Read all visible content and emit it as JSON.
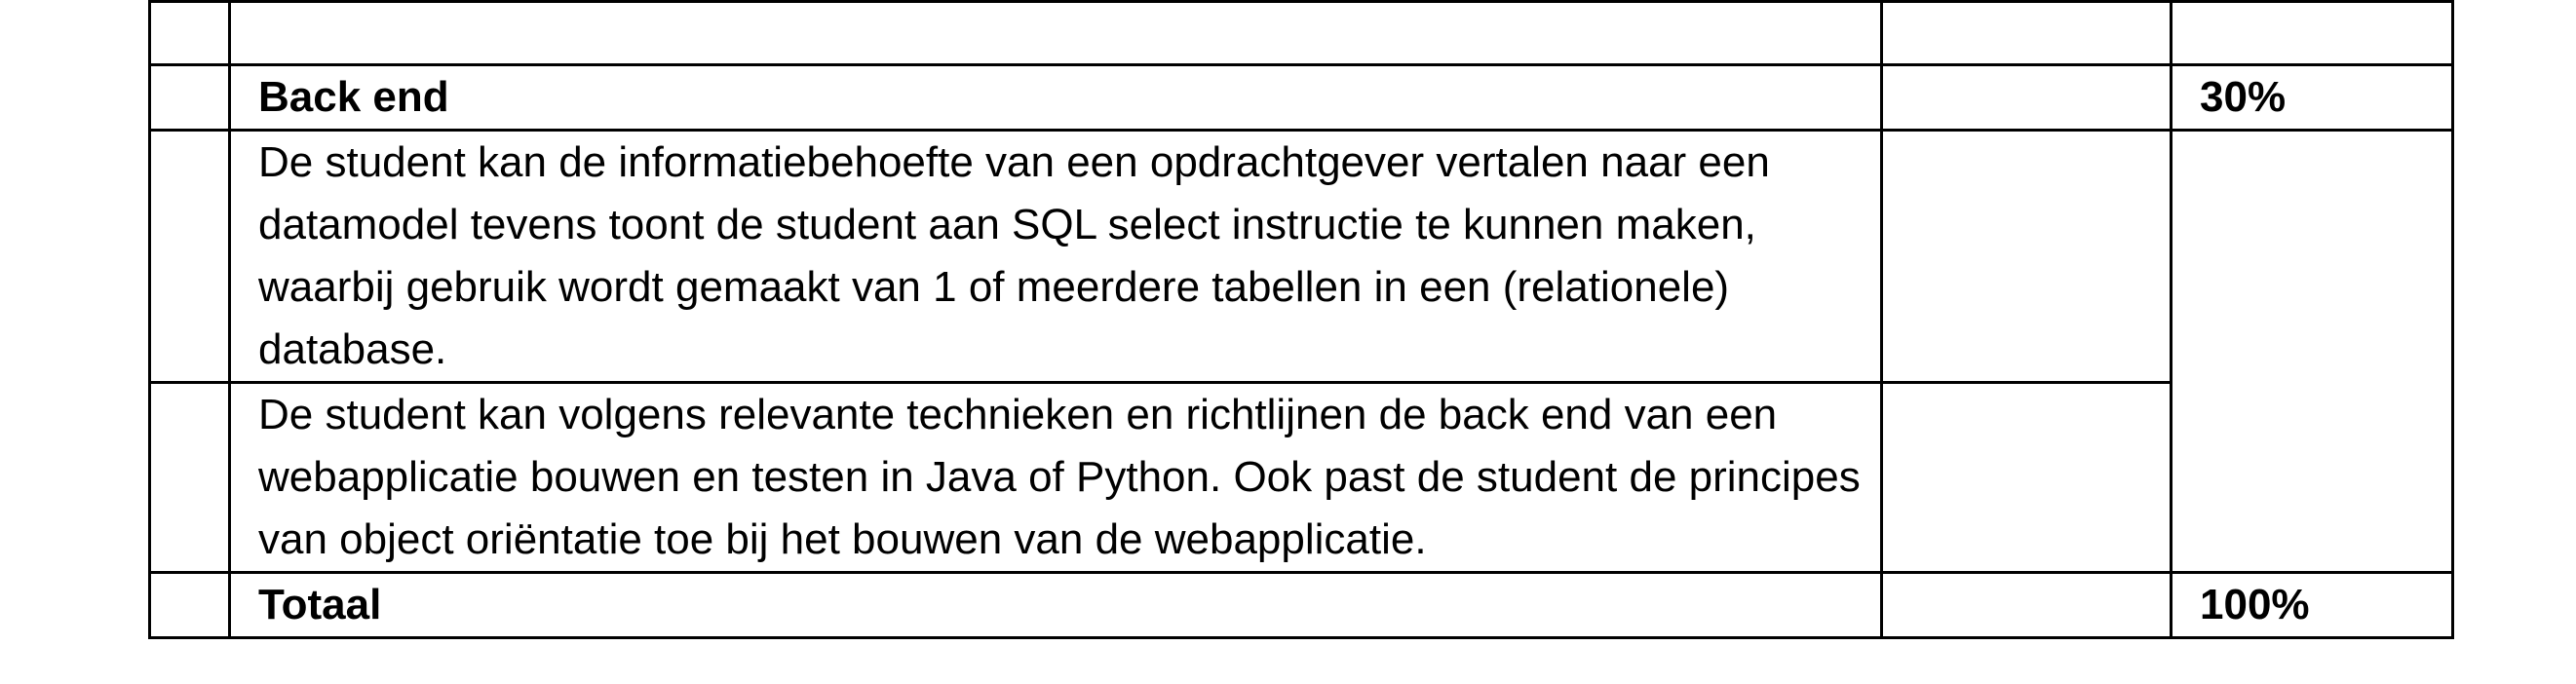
{
  "table": {
    "sections": [
      {
        "title": "Back end",
        "weight": "30%",
        "criteria": [
          "De student kan de informatiebehoefte van een opdrachtgever vertalen naar een datamodel tevens toont de student aan SQL select instructie te kunnen maken, waarbij gebruik wordt gemaakt van 1 of meerdere tabellen in een (relationele) database.",
          "De student kan volgens relevante technieken en richtlijnen de back end van een webapplicatie bouwen en testen in Java of Python. Ook past de student de principes van object oriëntatie toe bij het bouwen van de webapplicatie."
        ]
      }
    ],
    "total": {
      "label": "Totaal",
      "weight": "100%"
    }
  }
}
